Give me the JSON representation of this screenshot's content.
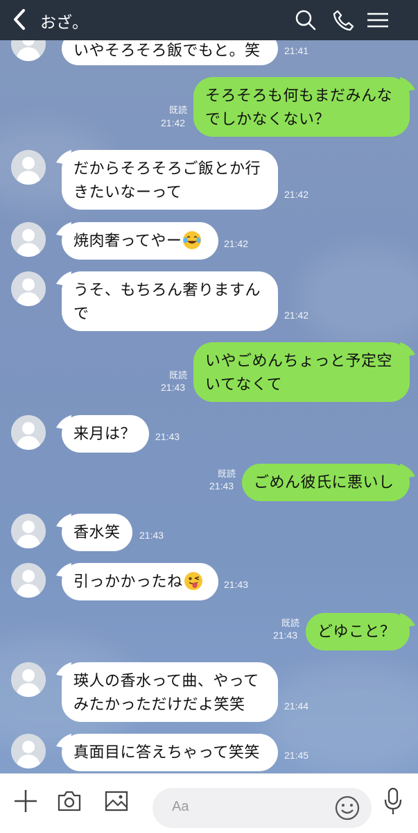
{
  "header": {
    "title": "おざ。",
    "icons": [
      "back-icon",
      "search-icon",
      "phone-icon",
      "menu-icon"
    ],
    "color": "#28323f"
  },
  "messages": [
    {
      "side": "in",
      "lines": [
        "いやそろそろ飯でもと。笑"
      ],
      "time": "21:41"
    },
    {
      "side": "out",
      "lines": [
        "そろそろも何もまだみんな",
        "でしかなくない？"
      ],
      "time": "21:42",
      "read": "既読"
    },
    {
      "side": "in",
      "lines": [
        "だからそろそろご飯とか行",
        "きたいなーって"
      ],
      "time": "21:42"
    },
    {
      "side": "in",
      "lines": [
        "焼肉奢ってやー"
      ],
      "emoji": "tears-of-joy-emoji",
      "time": "21:42"
    },
    {
      "side": "in",
      "lines": [
        "うそ、もちろん奢りますん",
        "で"
      ],
      "time": "21:42"
    },
    {
      "side": "out",
      "lines": [
        "いやごめんちょっと予定空",
        "いてなくて"
      ],
      "time": "21:43",
      "read": "既読"
    },
    {
      "side": "in",
      "lines": [
        "来月は？"
      ],
      "time": "21:43"
    },
    {
      "side": "out",
      "lines": [
        "ごめん彼氏に悪いし"
      ],
      "time": "21:43",
      "read": "既読"
    },
    {
      "side": "in",
      "lines": [
        "香水笑"
      ],
      "time": "21:43"
    },
    {
      "side": "in",
      "lines": [
        "引っかかったね"
      ],
      "emoji": "winking-tongue-emoji",
      "time": "21:43"
    },
    {
      "side": "out",
      "lines": [
        "どゆこと？"
      ],
      "time": "21:43",
      "read": "既読"
    },
    {
      "side": "in",
      "lines": [
        "瑛人の香水って曲、やって",
        "みたかっただけだよ笑笑"
      ],
      "time": "21:44"
    },
    {
      "side": "in",
      "lines": [
        "真面目に答えちゃって笑笑"
      ],
      "time": "21:45"
    }
  ],
  "footer": {
    "placeholder": "Aa",
    "icons": [
      "plus-icon",
      "camera-icon",
      "image-icon",
      "smiley-icon",
      "mic-icon"
    ]
  },
  "colors": {
    "incoming_bubble": "#ffffff",
    "outgoing_bubble": "#8de055",
    "chat_background": "#7e95bd"
  }
}
